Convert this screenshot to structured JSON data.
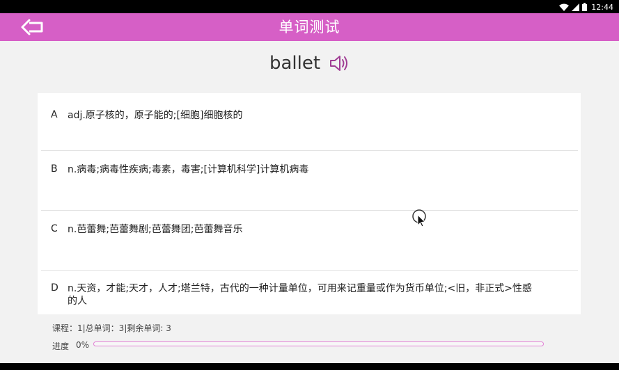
{
  "status_bar": {
    "time": "12:44"
  },
  "header": {
    "title": "单词测试"
  },
  "quiz": {
    "word": "ballet",
    "options": [
      {
        "letter": "A",
        "definition": "adj.原子核的，原子能的;[细胞]细胞核的"
      },
      {
        "letter": "B",
        "definition": "n.病毒;病毒性疾病;毒素，毒害;[计算机科学]计算机病毒"
      },
      {
        "letter": "C",
        "definition": "n.芭蕾舞;芭蕾舞剧;芭蕾舞团;芭蕾舞音乐"
      },
      {
        "letter": "D",
        "definition": "n.天资，才能;天才，人才;塔兰特，古代的一种计量单位，可用来记重量或作为货币单位;<旧，非正式>性感的人"
      }
    ]
  },
  "footer": {
    "info": "课程：1|总单词：3|剩余单词: 3",
    "progress_label": "进度",
    "progress_text": "0%",
    "progress_value": 0
  },
  "colors": {
    "accent": "#d65fc6",
    "background": "#f2f2f2"
  }
}
